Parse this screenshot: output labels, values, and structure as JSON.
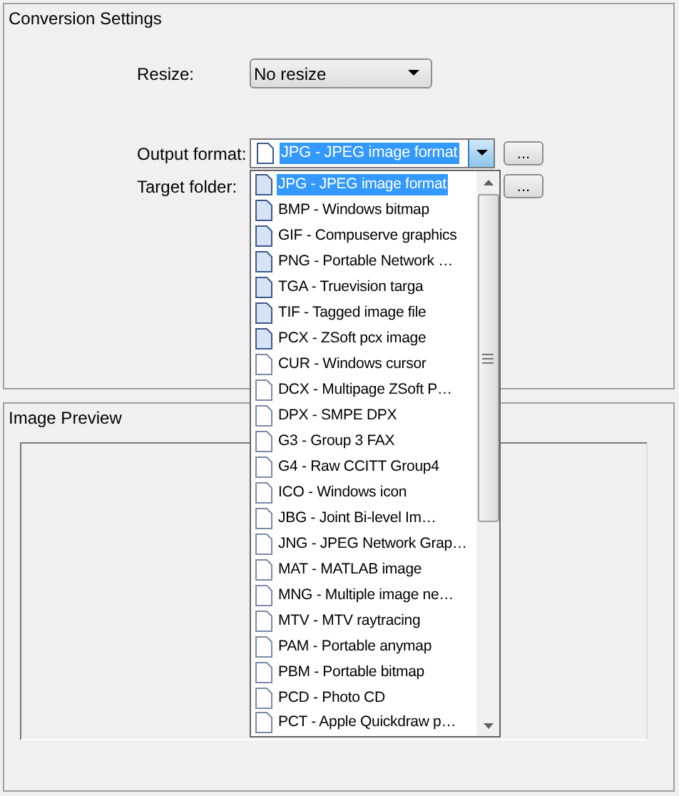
{
  "conversion_settings": {
    "title": "Conversion Settings",
    "resize": {
      "label": "Resize:",
      "value": "No resize"
    },
    "output_format": {
      "label": "Output format:",
      "value": "JPG - JPEG image format",
      "browse": "..."
    },
    "target_folder": {
      "label": "Target folder:",
      "browse": "..."
    }
  },
  "format_list": {
    "items": [
      {
        "text": "JPG - JPEG image format",
        "kind": "filled",
        "selected": true
      },
      {
        "text": "BMP - Windows bitmap",
        "kind": "filled",
        "selected": false
      },
      {
        "text": "GIF - Compuserve graphics",
        "kind": "filled",
        "selected": false
      },
      {
        "text": "PNG - Portable Network …",
        "kind": "filled",
        "selected": false
      },
      {
        "text": "TGA - Truevision targa",
        "kind": "filled",
        "selected": false
      },
      {
        "text": "TIF - Tagged image file",
        "kind": "filled",
        "selected": false
      },
      {
        "text": "PCX - ZSoft pcx image",
        "kind": "filled",
        "selected": false
      },
      {
        "text": "CUR - Windows cursor",
        "kind": "outline",
        "selected": false
      },
      {
        "text": "DCX - Multipage ZSoft P…",
        "kind": "outline",
        "selected": false
      },
      {
        "text": "DPX - SMPE DPX",
        "kind": "outline",
        "selected": false
      },
      {
        "text": "G3 - Group 3 FAX",
        "kind": "outline",
        "selected": false
      },
      {
        "text": "G4 - Raw CCITT Group4",
        "kind": "outline",
        "selected": false
      },
      {
        "text": "ICO - Windows icon",
        "kind": "outline",
        "selected": false
      },
      {
        "text": "JBG - Joint Bi-level Im…",
        "kind": "outline",
        "selected": false
      },
      {
        "text": "JNG - JPEG Network Grap…",
        "kind": "outline",
        "selected": false
      },
      {
        "text": "MAT - MATLAB image",
        "kind": "outline",
        "selected": false
      },
      {
        "text": "MNG - Multiple image ne…",
        "kind": "outline",
        "selected": false
      },
      {
        "text": "MTV - MTV raytracing",
        "kind": "outline",
        "selected": false
      },
      {
        "text": "PAM - Portable anymap",
        "kind": "outline",
        "selected": false
      },
      {
        "text": "PBM - Portable bitmap",
        "kind": "outline",
        "selected": false
      },
      {
        "text": "PCD - Photo CD",
        "kind": "outline",
        "selected": false
      },
      {
        "text": "PCT - Apple Quickdraw p…",
        "kind": "outline",
        "selected": false
      }
    ]
  },
  "image_preview": {
    "title": "Image Preview"
  }
}
